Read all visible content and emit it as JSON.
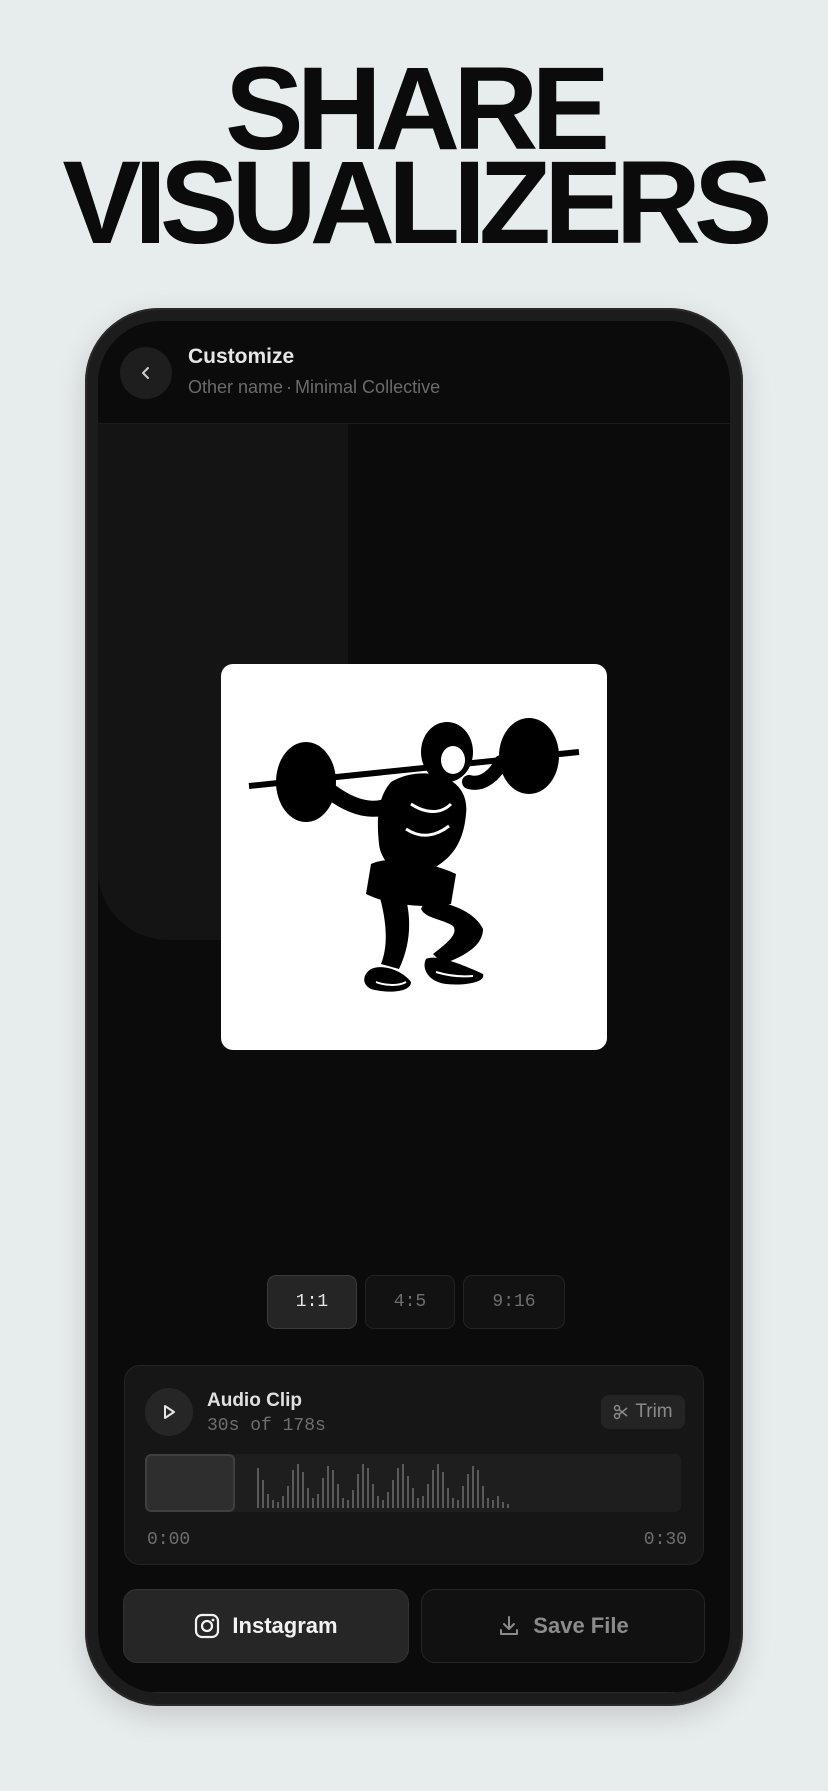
{
  "headline": {
    "line1": "SHARE",
    "line2": "VISUALIZERS"
  },
  "header": {
    "title": "Customize",
    "subtitle_left": "Other name",
    "subtitle_sep": "·",
    "subtitle_right": "Minimal Collective"
  },
  "aspect_ratios": [
    {
      "label": "1:1",
      "active": true
    },
    {
      "label": "4:5",
      "active": false
    },
    {
      "label": "9:16",
      "active": false
    }
  ],
  "audio": {
    "title": "Audio Clip",
    "subtitle": "30s of 178s",
    "trim_label": "Trim",
    "start_time": "0:00",
    "end_time": "0:30"
  },
  "actions": {
    "instagram_label": "Instagram",
    "save_label": "Save File"
  },
  "colors": {
    "background": "#e7ecec",
    "screen": "#0b0b0b",
    "accent_text": "#e6e6e6"
  }
}
